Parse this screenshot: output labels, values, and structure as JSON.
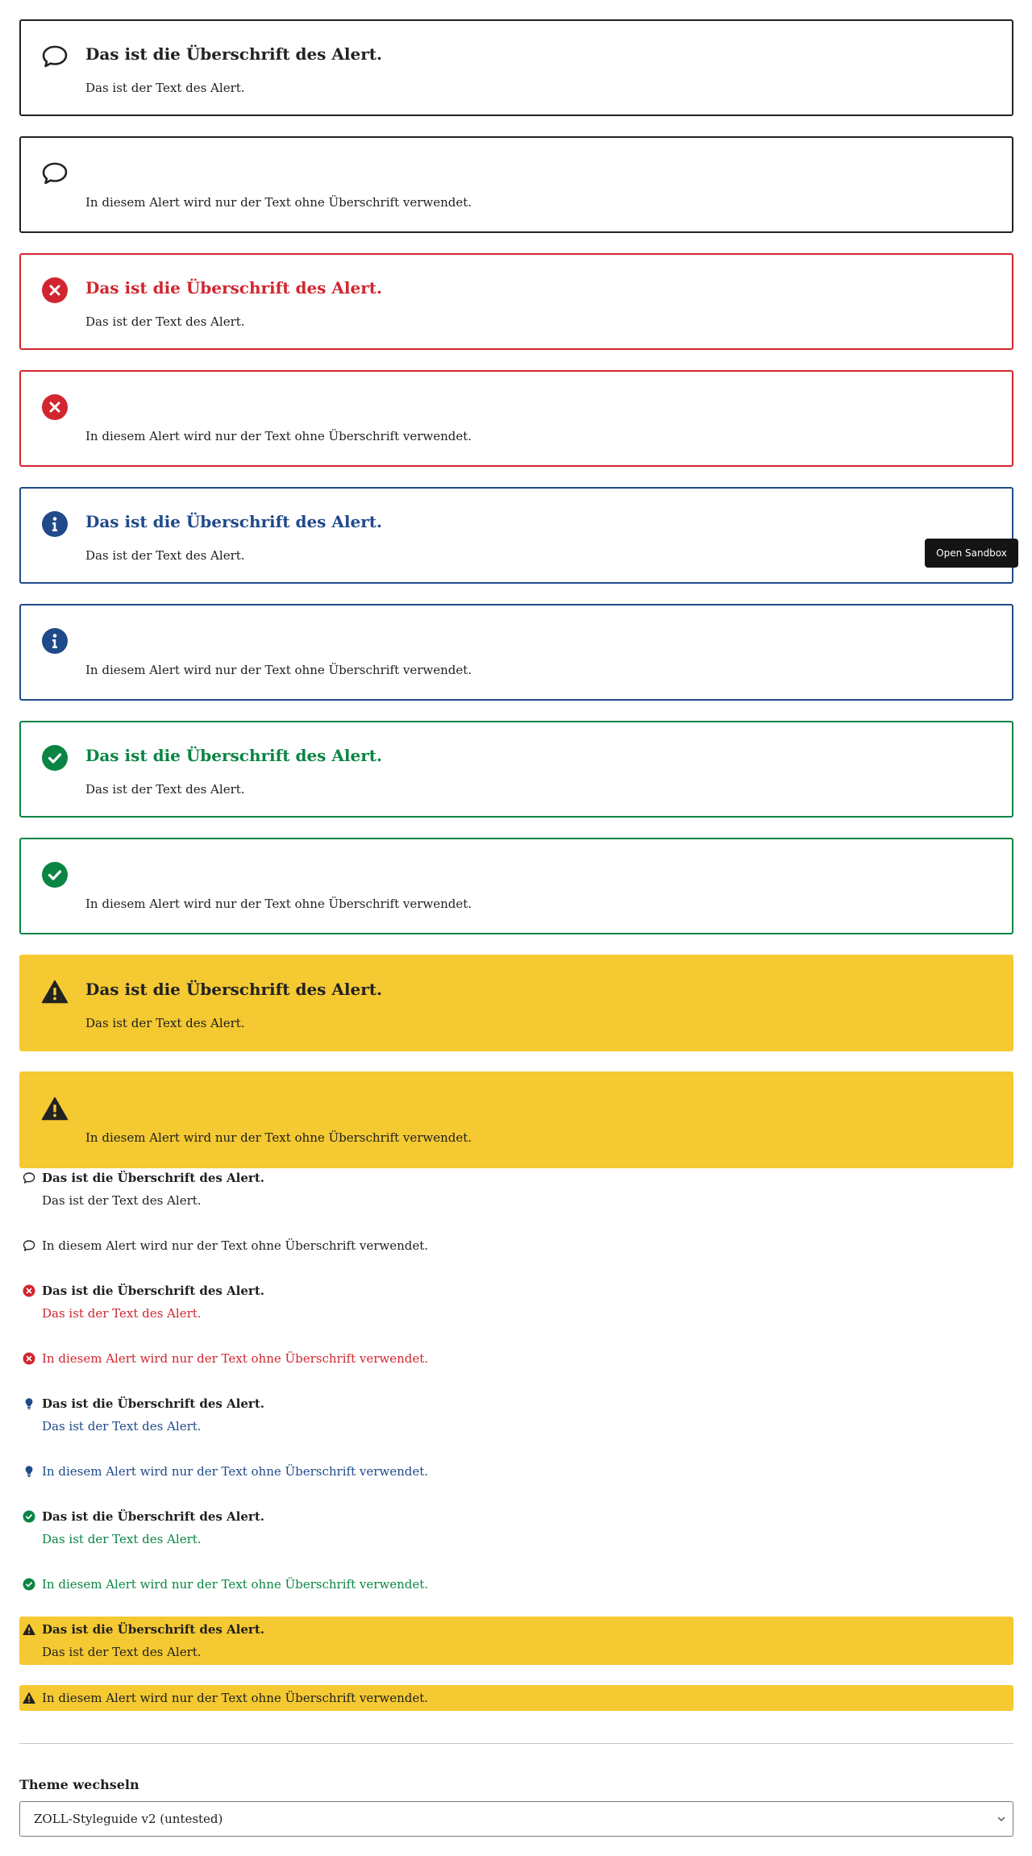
{
  "alerts": [
    {
      "variant": "neutral",
      "icon": "speech-bubble-icon",
      "title": "Das ist die Überschrift des Alert.",
      "text": "Das ist der Text des Alert."
    },
    {
      "variant": "neutral",
      "icon": "speech-bubble-icon",
      "title": "",
      "text": "In diesem Alert wird nur der Text ohne Überschrift verwendet."
    },
    {
      "variant": "error",
      "icon": "error-circle-icon",
      "title": "Das ist die Überschrift des Alert.",
      "text": "Das ist der Text des Alert."
    },
    {
      "variant": "error",
      "icon": "error-circle-icon",
      "title": "",
      "text": "In diesem Alert wird nur der Text ohne Überschrift verwendet."
    },
    {
      "variant": "info",
      "icon": "info-circle-icon",
      "title": "Das ist die Überschrift des Alert.",
      "text": "Das ist der Text des Alert."
    },
    {
      "variant": "info",
      "icon": "info-circle-icon",
      "title": "",
      "text": "In diesem Alert wird nur der Text ohne Überschrift verwendet."
    },
    {
      "variant": "success",
      "icon": "check-circle-icon",
      "title": "Das ist die Überschrift des Alert.",
      "text": "Das ist der Text des Alert."
    },
    {
      "variant": "success",
      "icon": "check-circle-icon",
      "title": "",
      "text": "In diesem Alert wird nur der Text ohne Überschrift verwendet."
    },
    {
      "variant": "warning",
      "icon": "warning-triangle-icon",
      "title": "Das ist die Überschrift des Alert.",
      "text": "Das ist der Text des Alert."
    },
    {
      "variant": "warning",
      "icon": "warning-triangle-icon",
      "title": "",
      "text": "In diesem Alert wird nur der Text ohne Überschrift verwendet."
    }
  ],
  "small_alerts": [
    {
      "variant": "neutral",
      "icon": "speech-bubble-icon",
      "title": "Das ist die Überschrift des Alert.",
      "text": "Das ist der Text des Alert."
    },
    {
      "variant": "neutral",
      "icon": "speech-bubble-icon",
      "title": "",
      "text": "In diesem Alert wird nur der Text ohne Überschrift verwendet."
    },
    {
      "variant": "error",
      "icon": "error-circle-icon",
      "title": "Das ist die Überschrift des Alert.",
      "text": "Das ist der Text des Alert."
    },
    {
      "variant": "error",
      "icon": "error-circle-icon",
      "title": "",
      "text": "In diesem Alert wird nur der Text ohne Überschrift verwendet."
    },
    {
      "variant": "info",
      "icon": "lightbulb-icon",
      "title": "Das ist die Überschrift des Alert.",
      "text": "Das ist der Text des Alert."
    },
    {
      "variant": "info",
      "icon": "lightbulb-icon",
      "title": "",
      "text": "In diesem Alert wird nur der Text ohne Überschrift verwendet."
    },
    {
      "variant": "success",
      "icon": "check-circle-icon",
      "title": "Das ist die Überschrift des Alert.",
      "text": "Das ist der Text des Alert."
    },
    {
      "variant": "success",
      "icon": "check-circle-icon",
      "title": "",
      "text": "In diesem Alert wird nur der Text ohne Überschrift verwendet."
    },
    {
      "variant": "warning",
      "icon": "warning-triangle-icon",
      "title": "Das ist die Überschrift des Alert.",
      "text": "Das ist der Text des Alert."
    },
    {
      "variant": "warning",
      "icon": "warning-triangle-icon",
      "title": "",
      "text": "In diesem Alert wird nur der Text ohne Überschrift verwendet."
    }
  ],
  "tooltip": {
    "label": "Open Sandbox"
  },
  "theme": {
    "label": "Theme wechseln",
    "selected": "ZOLL-Styleguide v2 (untested)"
  },
  "colors": {
    "neutral": "#222222",
    "error": "#d1262f",
    "info": "#204a8a",
    "success": "#0a8544",
    "warning": "#f4c932"
  }
}
